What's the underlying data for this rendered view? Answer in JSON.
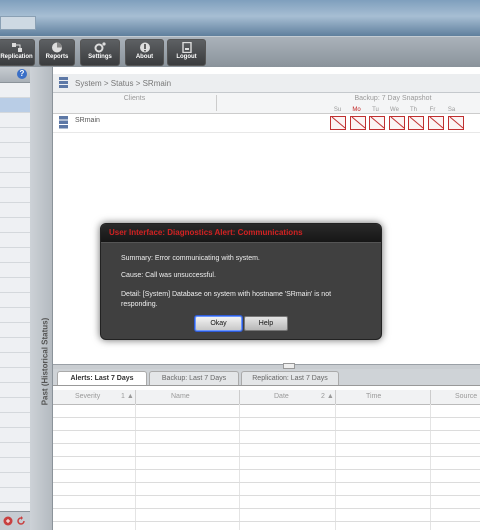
{
  "toolbar": {
    "buttons": [
      {
        "label": "Replication",
        "icon": "replication-icon"
      },
      {
        "label": "Reports",
        "icon": "reports-icon"
      },
      {
        "label": "Settings",
        "icon": "settings-icon"
      },
      {
        "label": "About",
        "icon": "about-icon"
      },
      {
        "label": "Logout",
        "icon": "logout-icon"
      }
    ]
  },
  "sidebar": {
    "help": "?"
  },
  "vertical_tab": {
    "label": "Past (Historical Status)"
  },
  "breadcrumb": {
    "text": "System > Status > SRmain"
  },
  "clients_table": {
    "clients_header": "Clients",
    "snapshot_header": "Backup: 7 Day Snapshot",
    "days": [
      "Su",
      "Mo",
      "Tu",
      "We",
      "Th",
      "Fr",
      "Sa"
    ],
    "today_index": 1,
    "rows": [
      {
        "name": "SRmain",
        "status": [
          "failed",
          "failed",
          "failed",
          "failed",
          "failed",
          "failed",
          "failed"
        ]
      }
    ]
  },
  "alerts": {
    "tabs": [
      "Alerts: Last 7 Days",
      "Backup: Last 7 Days",
      "Replication: Last 7 Days"
    ],
    "active_tab": 0,
    "columns": [
      "Severity",
      "1 ▲",
      "Name",
      "Date",
      "2 ▲",
      "Time",
      "Source"
    ]
  },
  "dialog": {
    "title": "User Interface: Diagnostics Alert: Communications",
    "summary": "Summary: Error communicating with system.",
    "cause": "Cause: Call was unsuccessful.",
    "detail": "Detail: [System] Database on system with hostname 'SRmain' is not responding.",
    "ok_label": "Okay",
    "help_label": "Help"
  },
  "colors": {
    "alert_title": "#d22222",
    "failed_box": "#c03030",
    "today_day": "#c02020"
  }
}
